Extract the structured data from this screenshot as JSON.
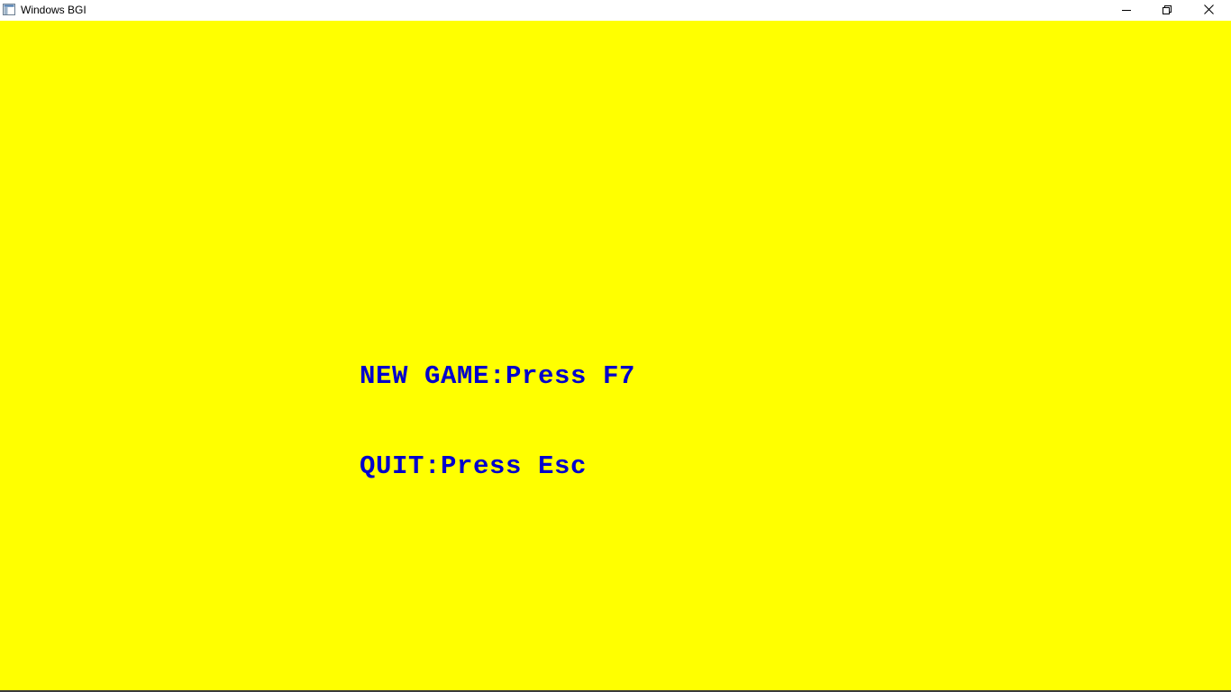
{
  "window": {
    "title": "Windows BGI",
    "icons": {
      "app": "app-window-icon",
      "minimize": "minimize-icon",
      "maximize": "restore-icon",
      "close": "close-icon"
    }
  },
  "game": {
    "background_color": "#ffff00",
    "text_color": "#0000cc",
    "menu": {
      "new_game": "NEW GAME:Press F7",
      "quit": "QUIT:Press Esc"
    }
  }
}
